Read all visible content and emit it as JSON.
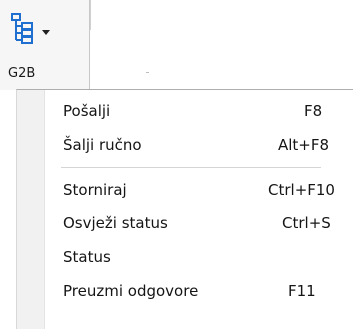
{
  "toolbar": {
    "button_label": "G2B",
    "button_icon": "tree-hierarchy-icon",
    "icon_color": "#1e6fd0"
  },
  "menu": {
    "group1": [
      {
        "label": "Pošalji",
        "shortcut": "F8"
      },
      {
        "label": "Šalji ručno",
        "shortcut": "Alt+F8"
      }
    ],
    "group2": [
      {
        "label": "Storniraj",
        "shortcut": "Ctrl+F10"
      },
      {
        "label": "Osvježi status",
        "shortcut": "Ctrl+S"
      },
      {
        "label": "Status",
        "shortcut": ""
      },
      {
        "label": "Preuzmi odgovore",
        "shortcut": "F11"
      }
    ]
  }
}
